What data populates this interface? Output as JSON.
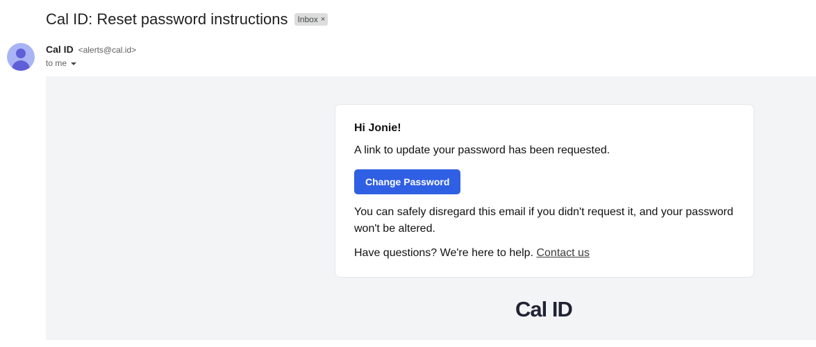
{
  "email": {
    "subject": "Cal ID: Reset password instructions",
    "label": "Inbox",
    "label_remove": "×",
    "sender_name": "Cal ID",
    "sender_email": "<alerts@cal.id>",
    "recipient": "to me"
  },
  "body": {
    "greeting": "Hi Jonie!",
    "line1": "A link to update your password has been requested.",
    "button_label": "Change Password",
    "line2": "You can safely disregard this email if you didn't request it, and your password won't be altered.",
    "line3_prefix": "Have questions? We're here to help. ",
    "contact_link": "Contact us",
    "logo_text": "Cal ID"
  },
  "colors": {
    "button": "#2f5fe3",
    "body_background": "#f3f4f6",
    "avatar": "#a8b4f4",
    "avatar_figure": "#5f5fd8"
  },
  "icons": {
    "avatar": "person-avatar-icon",
    "recipient_details": "caret-down-icon",
    "label_remove": "close-icon"
  }
}
